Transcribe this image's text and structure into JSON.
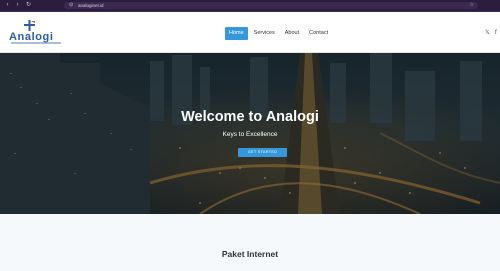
{
  "browser": {
    "url": "analoginet.id",
    "icons": {
      "back": "back-icon",
      "forward": "forward-icon",
      "reload": "reload-icon",
      "lock": "lock-icon",
      "bookmark": "star-icon"
    }
  },
  "brand": {
    "name": "Analogi",
    "color": "#2a5ca8"
  },
  "nav": {
    "items": [
      "Home",
      "Services",
      "About",
      "Contact"
    ],
    "active": "Home",
    "active_color": "#3498db"
  },
  "social": {
    "icons": [
      "x-twitter-icon",
      "facebook-icon"
    ],
    "glyphs": [
      "𝕏",
      "f"
    ]
  },
  "hero": {
    "title": "Welcome to Analogi",
    "subtitle": "Keys to Excellence",
    "cta_label": "GET STARTED",
    "background": "city-night-aerial"
  },
  "section": {
    "heading": "Paket Internet"
  }
}
